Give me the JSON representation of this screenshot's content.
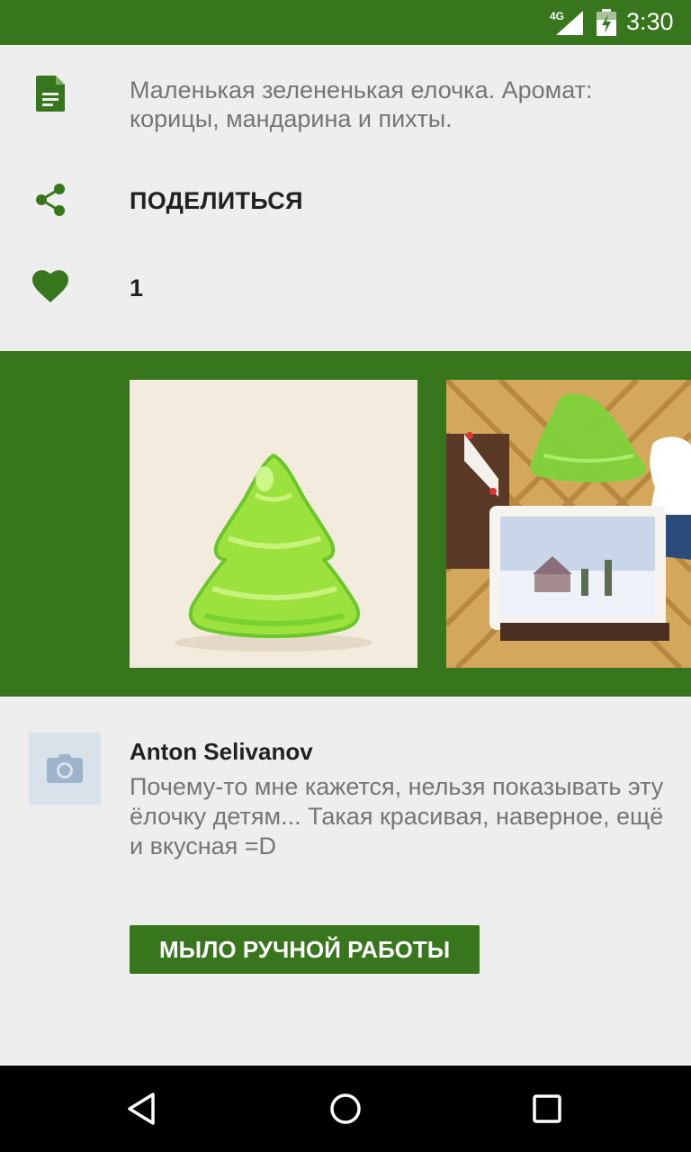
{
  "status_bar": {
    "network": "4G",
    "time": "3:30"
  },
  "description": {
    "icon": "document-icon",
    "text": "Маленькая зелененькая елочка. Аромат: корицы, мандарина и пихты."
  },
  "share": {
    "icon": "share-icon",
    "label": "ПОДЕЛИТЬСЯ"
  },
  "likes": {
    "icon": "heart-icon",
    "count": "1"
  },
  "gallery": {
    "photos": [
      "green-tree-soap-photo",
      "soap-assortment-photo"
    ]
  },
  "comment": {
    "avatar_icon": "camera-icon",
    "author": "Anton Selivanov",
    "text": "Почему-то мне кажется, нельзя показывать эту ёлочку детям... Такая красивая, наверное, ещё и вкусная =D"
  },
  "tag": {
    "label": "МЫЛО РУЧНОЙ РАБОТЫ"
  },
  "nav": {
    "back_icon": "back-icon",
    "home_icon": "home-icon",
    "recent_icon": "recent-apps-icon"
  },
  "colors": {
    "primary": "#38761d",
    "background": "#eeeeee"
  }
}
